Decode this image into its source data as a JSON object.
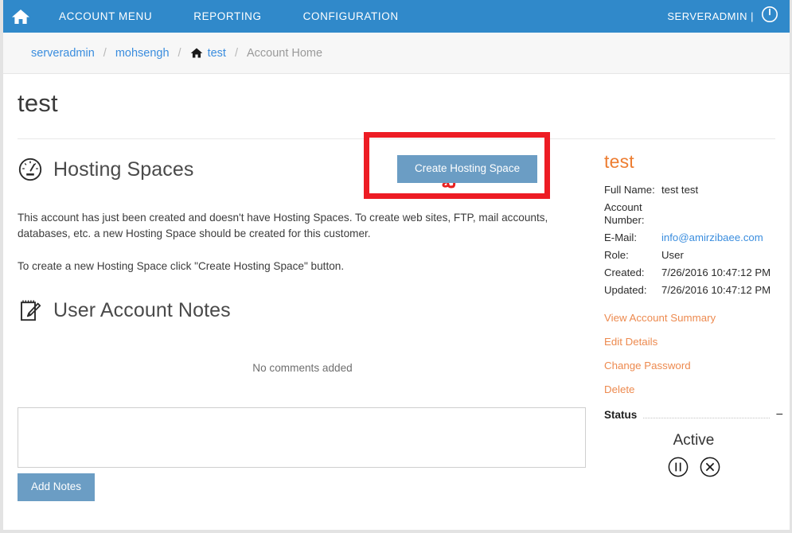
{
  "topnav": {
    "home_icon": "home-icon",
    "items": [
      {
        "label": "ACCOUNT MENU"
      },
      {
        "label": "REPORTING"
      },
      {
        "label": "CONFIGURATION"
      }
    ],
    "user_label": "SERVERADMIN |",
    "power_icon": "power-icon"
  },
  "breadcrumb": {
    "crumb1": "serveradmin",
    "crumb2": "mohsengh",
    "crumb3": "test",
    "current": "Account Home",
    "separator": "/",
    "home_icon": "home-icon"
  },
  "main": {
    "page_title": "test",
    "annotation_text": "نه",
    "hosting": {
      "icon": "gauge-icon",
      "heading": "Hosting Spaces",
      "create_button": "Create Hosting Space",
      "paragraph1": "This account has just been created and doesn't have Hosting Spaces. To create web sites, FTP, mail accounts, databases, etc. a new Hosting Space should be created for this customer.",
      "paragraph2": "To create a new Hosting Space click \"Create Hosting Space\" button."
    },
    "notes": {
      "icon": "notepad-pencil-icon",
      "heading": "User Account Notes",
      "empty_text": "No comments added",
      "textarea_value": "",
      "textarea_placeholder": "",
      "add_button": "Add Notes"
    }
  },
  "sidebar": {
    "title": "test",
    "fields": [
      {
        "label": "Full Name:",
        "value": "test test",
        "type": "text"
      },
      {
        "label": "Account Number:",
        "value": "",
        "type": "text"
      },
      {
        "label": "E-Mail:",
        "value": "info@amirzibaee.com",
        "type": "link"
      },
      {
        "label": "Role:",
        "value": "User",
        "type": "text"
      },
      {
        "label": "Created:",
        "value": "7/26/2016 10:47:12 PM",
        "type": "text"
      },
      {
        "label": "Updated:",
        "value": "7/26/2016 10:47:12 PM",
        "type": "text"
      }
    ],
    "actions": [
      {
        "label": "View Account Summary"
      },
      {
        "label": "Edit Details"
      },
      {
        "label": "Change Password"
      },
      {
        "label": "Delete"
      }
    ],
    "status": {
      "section_label": "Status",
      "collapse_toggle": "−",
      "value": "Active",
      "pause_icon": "pause-circle-icon",
      "cancel_icon": "close-circle-icon"
    }
  },
  "colors": {
    "nav_blue": "#3089ca",
    "button_blue": "#6b9dc4",
    "link_blue": "#3a8dde",
    "accent_orange": "#ed7d31",
    "annotation_red": "#ed1c24"
  }
}
